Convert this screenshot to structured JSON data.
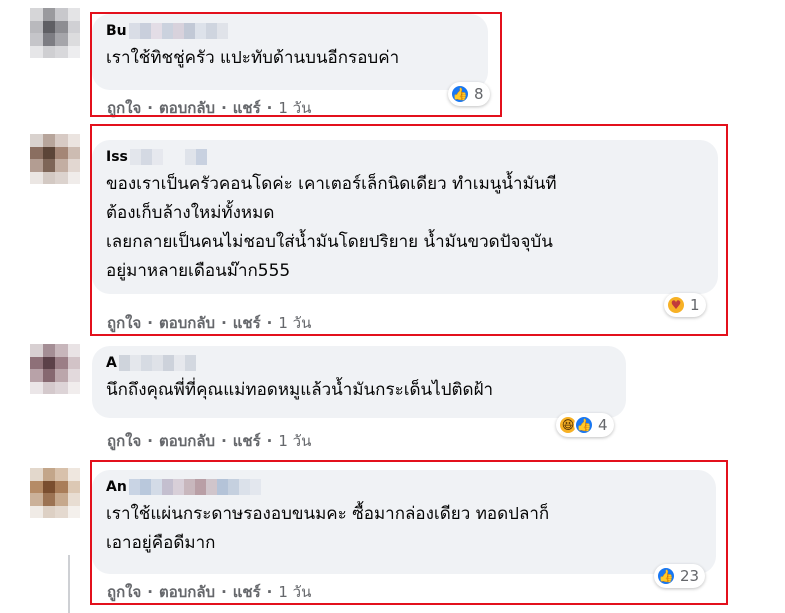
{
  "comments": [
    {
      "author": "Bu",
      "text_lines": [
        "เราใช้ทิชชู่ครัว แปะทับด้านบนอีกรอบค่า"
      ],
      "actions": {
        "like": "ถูกใจ",
        "reply": "ตอบกลับ",
        "share": "แชร์",
        "time": "1 วัน"
      },
      "reaction_count": "8",
      "reaction_icons": [
        "like-icon"
      ]
    },
    {
      "author": "Iss",
      "text_lines": [
        "ของเราเป็นครัวคอนโดค่ะ เคาเตอร์เล็กนิดเดียว ทำเมนูน้ำมันที",
        "ต้องเก็บล้างใหม่ทั้งหมด",
        "เลยกลายเป็นคนไม่ชอบใส่น้ำมันโดยปริยาย น้ำมันขวดปัจจุบัน",
        "อยู่มาหลายเดือนม๊าก555"
      ],
      "actions": {
        "like": "ถูกใจ",
        "reply": "ตอบกลับ",
        "share": "แชร์",
        "time": "1 วัน"
      },
      "reaction_count": "1",
      "reaction_icons": [
        "care-icon"
      ]
    },
    {
      "author": "A",
      "text_lines": [
        "นึกถึงคุณพี่ที่คุณแม่ทอดหมูแล้วน้ำมันกระเด็นไปติดฝ้า"
      ],
      "actions": {
        "like": "ถูกใจ",
        "reply": "ตอบกลับ",
        "share": "แชร์",
        "time": "1 วัน"
      },
      "reaction_count": "4",
      "reaction_icons": [
        "haha-icon",
        "like-icon"
      ]
    },
    {
      "author": "An",
      "text_lines": [
        "เราใช้แผ่นกระดาษรองอบขนมคะ ซื้อมากล่องเดียว ทอดปลาก็",
        "เอาอยู่คือดีมาก"
      ],
      "actions": {
        "like": "ถูกใจ",
        "reply": "ตอบกลับ",
        "share": "แชร์",
        "time": "1 วัน"
      },
      "reaction_count": "23",
      "reaction_icons": [
        "like-icon"
      ]
    }
  ],
  "colors": {
    "bubble": "#f0f2f5",
    "highlight": "#e3101c",
    "action_text": "#65676b",
    "like_blue": "#1877f2"
  }
}
